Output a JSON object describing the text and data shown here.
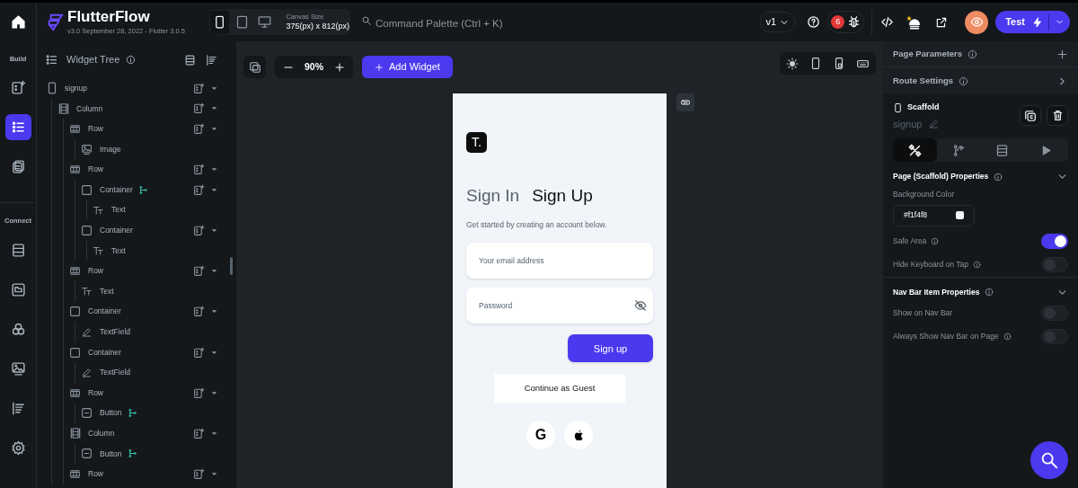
{
  "topbar": {
    "app_name": "FlutterFlow",
    "version": "v3.0 September 28, 2022 - Flutter 3.0.5",
    "devices": [
      {
        "kind": "phone",
        "selected": true
      },
      {
        "kind": "tablet",
        "selected": false
      },
      {
        "kind": "desktop",
        "selected": false
      }
    ],
    "canvas_size_label": "Canvas Size",
    "canvas_size": "375(px) x 812(px)",
    "command_palette": {
      "placeholder": "Command Palette (Ctrl + K)"
    },
    "version_select": "v1",
    "issue_count": "6",
    "test_button": "Test"
  },
  "rail": {
    "sections": [
      {
        "label": "Build",
        "items": [
          {
            "kind": "add-widget",
            "selected": false
          },
          {
            "kind": "tree",
            "selected": true
          },
          {
            "kind": "pages",
            "selected": false
          }
        ]
      },
      {
        "label": "Connect",
        "items": [
          {
            "kind": "database",
            "selected": false
          },
          {
            "kind": "folder",
            "selected": false
          },
          {
            "kind": "circles",
            "selected": false
          },
          {
            "kind": "image",
            "selected": false
          },
          {
            "kind": "text",
            "selected": false
          },
          {
            "kind": "settings",
            "selected": false
          }
        ]
      }
    ]
  },
  "widget_tree": {
    "title": "Widget Tree",
    "nodes": [
      {
        "label": "signup",
        "kind": "page",
        "expandable": true,
        "has_action": false,
        "children": [
          {
            "label": "Column",
            "kind": "column",
            "expandable": true,
            "has_action": false,
            "children": [
              {
                "label": "Row",
                "kind": "row",
                "expandable": true,
                "has_action": false,
                "children": [
                  {
                    "label": "Image",
                    "kind": "image",
                    "expandable": false,
                    "has_action": false
                  }
                ]
              },
              {
                "label": "Row",
                "kind": "row",
                "expandable": true,
                "has_action": false,
                "children": [
                  {
                    "label": "Container",
                    "kind": "container",
                    "expandable": true,
                    "has_action": true,
                    "children": [
                      {
                        "label": "Text",
                        "kind": "text",
                        "expandable": false,
                        "has_action": false
                      }
                    ]
                  },
                  {
                    "label": "Container",
                    "kind": "container",
                    "expandable": true,
                    "has_action": false,
                    "children": [
                      {
                        "label": "Text",
                        "kind": "text",
                        "expandable": false,
                        "has_action": false
                      }
                    ]
                  }
                ]
              },
              {
                "label": "Row",
                "kind": "row",
                "expandable": true,
                "has_action": false,
                "children": [
                  {
                    "label": "Text",
                    "kind": "text",
                    "expandable": false,
                    "has_action": false
                  }
                ]
              },
              {
                "label": "Container",
                "kind": "container",
                "expandable": true,
                "has_action": false,
                "children": [
                  {
                    "label": "TextField",
                    "kind": "textfield",
                    "expandable": false,
                    "has_action": false
                  }
                ]
              },
              {
                "label": "Container",
                "kind": "container",
                "expandable": true,
                "has_action": false,
                "children": [
                  {
                    "label": "TextField",
                    "kind": "textfield",
                    "expandable": false,
                    "has_action": false
                  }
                ]
              },
              {
                "label": "Row",
                "kind": "row",
                "expandable": true,
                "has_action": false,
                "children": [
                  {
                    "label": "Button",
                    "kind": "button",
                    "expandable": false,
                    "has_action": true
                  }
                ]
              },
              {
                "label": "Column",
                "kind": "column",
                "expandable": true,
                "has_action": false,
                "children": [
                  {
                    "label": "Button",
                    "kind": "button",
                    "expandable": false,
                    "has_action": true
                  }
                ]
              },
              {
                "label": "Row",
                "kind": "row",
                "expandable": true,
                "has_action": false
              }
            ]
          }
        ]
      }
    ]
  },
  "canvas": {
    "zoom": "90%",
    "add_widget": "Add Widget",
    "phone": {
      "logo": "T.",
      "tabs": [
        {
          "label": "Sign In",
          "selected": false
        },
        {
          "label": "Sign Up",
          "selected": true
        }
      ],
      "subtitle": "Get started by creating an account below.",
      "fields": [
        {
          "kind": "text",
          "placeholder": "Your email address"
        },
        {
          "kind": "password",
          "placeholder": "Password"
        }
      ],
      "primary_button": "Sign up",
      "secondary_button": "Continue as Guest",
      "social": [
        {
          "kind": "google",
          "glyph": "G"
        },
        {
          "kind": "apple"
        }
      ]
    }
  },
  "properties": {
    "page_parameters": "Page Parameters",
    "route_settings": "Route Settings",
    "widget_type": "Scaffold",
    "widget_name": "signup",
    "tabs": [
      {
        "kind": "properties",
        "selected": true
      },
      {
        "kind": "actions",
        "selected": false
      },
      {
        "kind": "backend",
        "selected": false
      },
      {
        "kind": "preview",
        "selected": false
      }
    ],
    "sections": [
      {
        "title": "Page (Scaffold) Properties",
        "expanded": true,
        "color_label": "Background Color",
        "color_value": "#f1f4f8",
        "toggles": [
          {
            "label": "Safe Area",
            "info": true,
            "on": true
          },
          {
            "label": "Hide Keyboard on Tap",
            "info": true,
            "on": false
          }
        ]
      },
      {
        "title": "Nav Bar Item Properties",
        "expanded": true,
        "toggles": [
          {
            "label": "Show on Nav Bar",
            "info": false,
            "on": false
          },
          {
            "label": "Always Show Nav Bar on Page",
            "info": true,
            "on": false
          }
        ]
      }
    ]
  }
}
